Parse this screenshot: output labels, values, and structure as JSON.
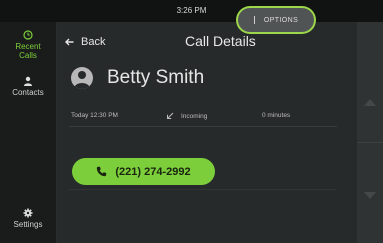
{
  "status_bar": {
    "time": "3:26 PM"
  },
  "sidebar": {
    "items": [
      {
        "label": "Recent\nCalls",
        "icon": "clock-icon",
        "active": true
      },
      {
        "label": "Contacts",
        "icon": "person-icon",
        "active": false
      },
      {
        "label": "Settings",
        "icon": "gear-icon",
        "active": false
      }
    ]
  },
  "header": {
    "back_label": "Back",
    "title": "Call Details",
    "options_label": "OPTIONS"
  },
  "contact": {
    "name": "Betty Smith"
  },
  "call_log": {
    "time": "Today 12:30 PM",
    "direction": "Incoming",
    "duration": "0 minutes"
  },
  "call_button": {
    "number": "(221) 274-2992"
  },
  "colors": {
    "accent": "#7ccf3a",
    "background": "#272a2a",
    "sidebar": "#1a1c1c",
    "highlight_ring": "#9cd64a"
  }
}
